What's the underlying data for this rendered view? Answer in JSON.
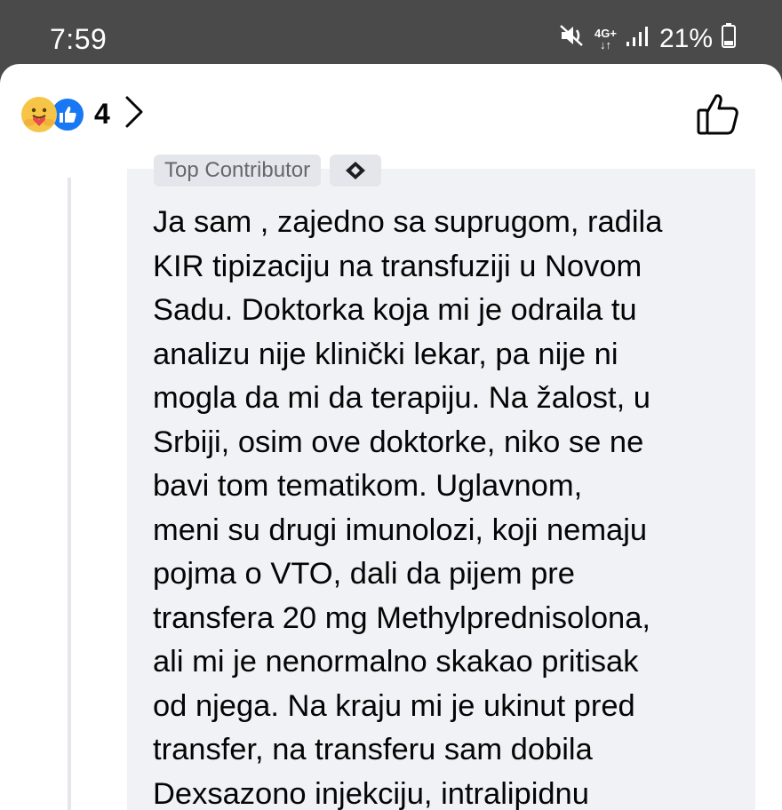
{
  "status_bar": {
    "time": "7:59",
    "network_top": "4G+",
    "network_bottom": "↓↑",
    "battery_percent": "21%",
    "icons": [
      "mute-vibrate-icon",
      "network-4g-icon",
      "signal-icon",
      "battery-icon"
    ]
  },
  "reactions": {
    "count": "4",
    "types": [
      "care-icon",
      "like-icon"
    ]
  },
  "comment": {
    "badge": "Top Contributor",
    "lines": [
      "Ja sam , zajedno sa suprugom, radila",
      "KIR tipizaciju na transfuziji u Novom",
      "Sadu. Doktorka koja mi je odraila tu",
      "analizu nije klinički lekar, pa nije ni",
      "mogla da mi da terapiju. Na žalost, u",
      "Srbiji, osim ove doktorke, niko se ne",
      "bavi tom tematikom.  Uglavnom,",
      "meni su drugi imunolozi, koji nemaju",
      "pojma o VTO, dali da pijem pre",
      "transfera 20 mg Methylprednisolona,",
      "ali mi je nenormalno skakao pritisak",
      "od njega. Na kraju mi je ukinut pred",
      "transfer, na transferu sam dobila",
      "Dexsazono injekciju, intralipidnu"
    ]
  },
  "colors": {
    "status_bg": "#4a4a4a",
    "bubble_bg": "#f0f2f5",
    "like_blue": "#1877f2",
    "care_yellow": "#f6c547",
    "text": "#050505"
  }
}
